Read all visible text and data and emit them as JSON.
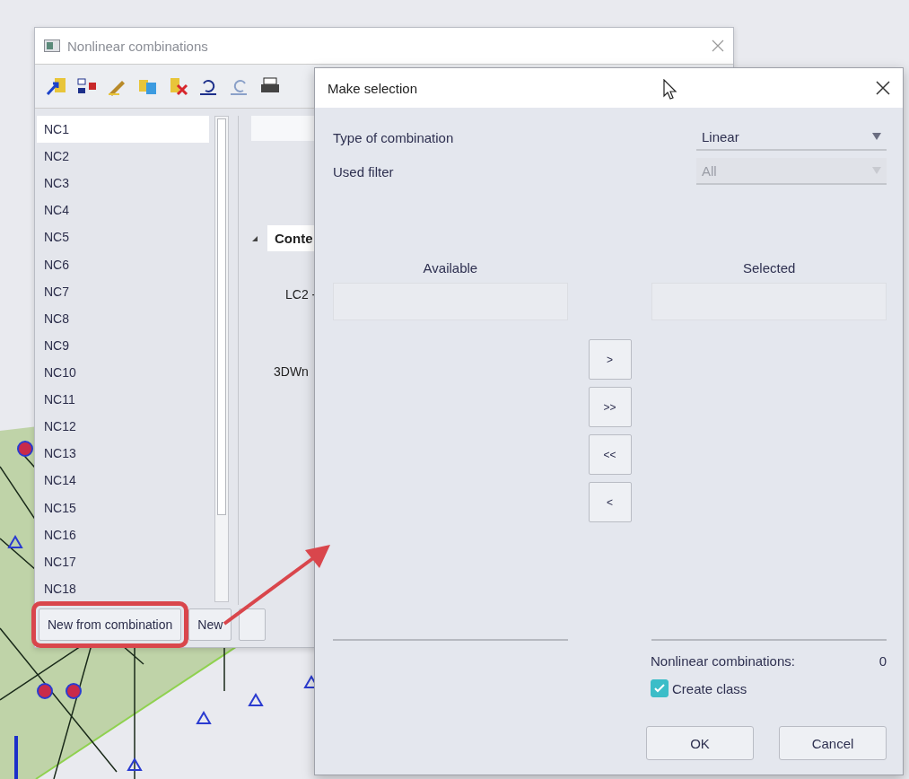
{
  "back_window": {
    "title": "Nonlinear combinations",
    "list": [
      {
        "label": "NC1",
        "selected": true
      },
      {
        "label": "NC2",
        "selected": false
      },
      {
        "label": "NC3",
        "selected": false
      },
      {
        "label": "NC4",
        "selected": false
      },
      {
        "label": "NC5",
        "selected": false
      },
      {
        "label": "NC6",
        "selected": false
      },
      {
        "label": "NC7",
        "selected": false
      },
      {
        "label": "NC8",
        "selected": false
      },
      {
        "label": "NC9",
        "selected": false
      },
      {
        "label": "NC10",
        "selected": false
      },
      {
        "label": "NC11",
        "selected": false
      },
      {
        "label": "NC12",
        "selected": false
      },
      {
        "label": "NC13",
        "selected": false
      },
      {
        "label": "NC14",
        "selected": false
      },
      {
        "label": "NC15",
        "selected": false
      },
      {
        "label": "NC16",
        "selected": false
      },
      {
        "label": "NC17",
        "selected": false
      },
      {
        "label": "NC18",
        "selected": false
      }
    ],
    "section": {
      "title": "Conte",
      "expanded": true
    },
    "section_rows": [
      "LC2 -",
      "3DWn"
    ],
    "buttons": [
      {
        "label": "New from combination",
        "highlighted": true
      },
      {
        "label": "New",
        "highlighted": false
      }
    ]
  },
  "dialog": {
    "title": "Make selection",
    "fields": [
      {
        "label": "Type of combination",
        "value": "Linear",
        "disabled": false
      },
      {
        "label": "Used filter",
        "value": "All",
        "disabled": true
      }
    ],
    "available": {
      "header": "Available"
    },
    "selected": {
      "header": "Selected"
    },
    "transfer_buttons": [
      ">",
      ">>",
      "<<",
      "<"
    ],
    "count_label": "Nonlinear combinations:",
    "count_value": "0",
    "create_class": {
      "label": "Create class",
      "checked": true
    },
    "buttons": [
      "OK",
      "Cancel"
    ]
  }
}
